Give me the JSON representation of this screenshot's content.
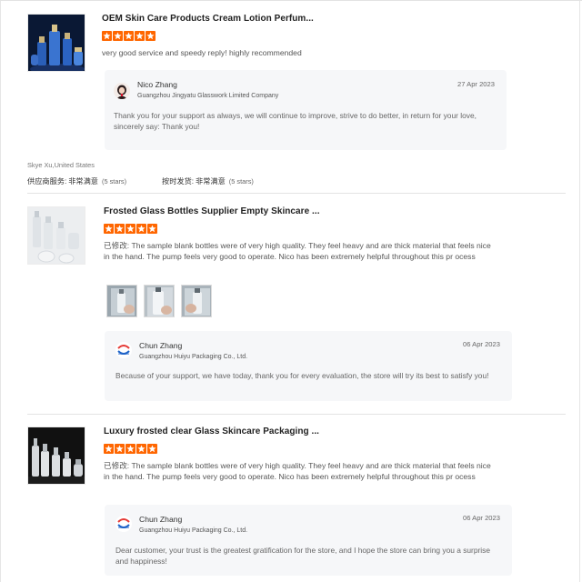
{
  "reviews": [
    {
      "product_title": "OEM Skin Care Products Cream Lotion Perfum...",
      "rating": 5,
      "body_prefix": "",
      "body": "very good service and speedy reply! highly recommended",
      "photos": [],
      "reply": {
        "name": "Nico Zhang",
        "company": "Guangzhou Jingyatu Glasswork Limited Company",
        "date": "27 Apr 2023",
        "text": "Thank you for your support as always, we will continue to improve, strive to do better, in return for your love, sincerely say: Thank you!"
      },
      "reviewer": "Skye Xu,United States",
      "ratings_row": [
        {
          "label": "供应商服务:",
          "value": "非常满意",
          "stars_text": "(5 stars)"
        },
        {
          "label": "按时发货:",
          "value": "非常满意",
          "stars_text": "(5 stars)"
        }
      ]
    },
    {
      "product_title": "Frosted Glass Bottles Supplier Empty Skincare ...",
      "rating": 5,
      "body_prefix": "已修改:",
      "body": " The sample blank bottles were of very high quality.  They feel heavy and are thick material that feels nice in the hand.  The pump feels very good to operate.  Nico has been extremely helpful throughout this pr ocess",
      "photos": [
        "photo-1",
        "photo-2",
        "photo-3"
      ],
      "reply": {
        "name": "Chun Zhang",
        "company": "Guangzhou Huiyu Packaging Co., Ltd.",
        "date": "06 Apr 2023",
        "text": "Because of your support, we have today, thank you for every evaluation, the store will try its best to satisfy you!"
      }
    },
    {
      "product_title": "Luxury frosted clear Glass Skincare Packaging ...",
      "rating": 5,
      "body_prefix": "已修改:",
      "body": " The sample blank bottles were of very high quality.  They feel heavy and are thick material that feels nice in the hand.  The pump feels very good to operate.  Nico has been extremely helpful throughout this pr ocess",
      "photos": [],
      "reply": {
        "name": "Chun Zhang",
        "company": "Guangzhou Huiyu Packaging Co., Ltd.",
        "date": "06 Apr 2023",
        "text": "Dear customer, your trust is the greatest gratification for the store, and I hope the store can bring you a surprise and happiness!"
      }
    }
  ],
  "colors": {
    "star": "#ff6600",
    "reply_bg": "#f6f7f9",
    "divider": "#e3e3e3"
  },
  "icons": {
    "star": "star-icon",
    "supplier_logo": "huiyu-logo-icon",
    "avatar": "person-avatar"
  }
}
